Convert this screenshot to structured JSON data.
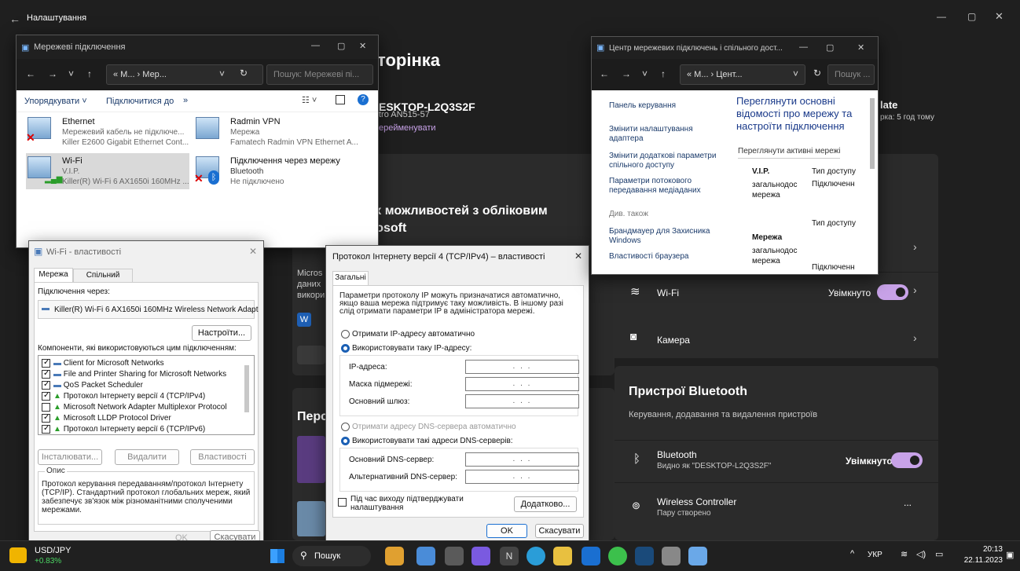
{
  "settings": {
    "title": "Налаштування",
    "heading_partial": "торінка",
    "device_name": "ESKTOP-L2Q3S2F",
    "device_model": "tro AN515-57",
    "rename": "ерейменувати",
    "update_partial": "late",
    "update_sub": "рка: 5 год тому",
    "ms_heading_1": "іх можливостей з обліковим",
    "ms_heading_2": "rosoft",
    "ms_text_1": "Micros",
    "ms_text_2": "даних",
    "ms_text_3": "викори",
    "personal_partial": "Перс",
    "wifi_label": "Wi-Fi",
    "wifi_state": "Увімкнуто",
    "camera_label": "Камера",
    "bt_section_title": "Пристрої Bluetooth",
    "bt_section_sub": "Керування, додавання та видалення пристроїв",
    "bt_label": "Bluetooth",
    "bt_sub": "Видно як \"DESKTOP-L2Q3S2F\"",
    "bt_state": "Увімкнуто",
    "ctrl_label": "Wireless Controller",
    "ctrl_sub": "Пару створено",
    "ctrl_more": "...",
    "accent": "#c8a2e8"
  },
  "netconn": {
    "title": "Мережеві підключення",
    "address": "« M... › Мер...",
    "search_placeholder": "Пошук: Мережеві пі...",
    "cmd_organize": "Упорядкувати ˅",
    "cmd_connect": "Підключитися до",
    "cmd_more": "»",
    "adapters": [
      {
        "name": "Ethernet",
        "status": "Мережевий кабель не підключе...",
        "device": "Killer E2600 Gigabit Ethernet Cont..."
      },
      {
        "name": "Radmin VPN",
        "status": "Мережа",
        "device": "Famatech Radmin VPN Ethernet A..."
      },
      {
        "name": "Wi-Fi",
        "status": "V.I.P.",
        "device": "Killer(R) Wi-Fi 6 AX1650i 160MHz ..."
      },
      {
        "name": "Підключення через мережу",
        "status": "Bluetooth",
        "device": "Не підключено"
      }
    ]
  },
  "wifiprops": {
    "title": "Wi-Fi - властивості",
    "tab_net": "Мережа",
    "tab_share": "Спільний доступ",
    "connect_via": "Підключення через:",
    "adapter": "Killer(R) Wi-Fi 6 AX1650i 160MHz Wireless Network Adapt",
    "configure": "Настроїти...",
    "components_label": "Компоненти, які використовуються цим підключенням:",
    "components": [
      {
        "label": "Client for Microsoft Networks",
        "checked": true
      },
      {
        "label": "File and Printer Sharing for Microsoft Networks",
        "checked": true
      },
      {
        "label": "QoS Packet Scheduler",
        "checked": true
      },
      {
        "label": "Протокол Інтернету версії 4 (TCP/IPv4)",
        "checked": true
      },
      {
        "label": "Microsoft Network Adapter Multiplexor Protocol",
        "checked": false
      },
      {
        "label": "Microsoft LLDP Protocol Driver",
        "checked": true
      },
      {
        "label": "Протокол Інтернету версії 6 (TCP/IPv6)",
        "checked": true
      }
    ],
    "install": "Інсталювати...",
    "remove": "Видалити",
    "properties": "Властивості",
    "desc_title": "Опис",
    "desc_text": "Протокол керування передаванням/протокол Інтернету (TCP/IP). Стандартний протокол глобальних мереж, який забезпечує зв'язок між різноманітними сполученими мережами.",
    "ok": "OK",
    "cancel": "Скасувати"
  },
  "ipv4": {
    "title": "Протокол Інтернету версії 4 (TCP/IPv4) – властивості",
    "tab": "Загальні",
    "intro": "Параметри протоколу IP можуть призначатися автоматично, якщо ваша мережа підтримує таку можливість. В іншому разі слід отримати параметри IP в адміністратора мережі.",
    "auto_ip": "Отримати IP-адресу автоматично",
    "manual_ip": "Використовувати таку IP-адресу:",
    "ip_label": "IP-адреса:",
    "mask_label": "Маска підмережі:",
    "gw_label": "Основний шлюз:",
    "auto_dns": "Отримати адресу DNS-сервера автоматично",
    "manual_dns": "Використовувати такі адреси DNS-серверів:",
    "dns1_label": "Основний DNS-сервер:",
    "dns2_label": "Альтернативний DNS-сервер:",
    "ip_placeholder": ". . .",
    "validate": "Під час виходу підтверджувати налаштування",
    "advanced": "Додатково...",
    "ok": "OK",
    "cancel": "Скасувати"
  },
  "netcenter": {
    "title": "Центр мережевих підключень і спільного дост...",
    "address": "« M... › Цент...",
    "search_placeholder": "Пошук ...",
    "side_home": "Панель керування",
    "side_adapter": "Змінити налаштування адаптера",
    "side_sharing": "Змінити додаткові параметри спільного доступу",
    "side_media": "Параметри потокового передавання медіаданих",
    "see_also": "Див. також",
    "firewall": "Брандмауер для Захисника Windows",
    "browser": "Властивості браузера",
    "main_heading": "Переглянути основні відомості про мережу та настроїти підключення",
    "active_nets": "Переглянути активні мережі",
    "net1_name": "V.I.P.",
    "net1_type": "загальнодос мережа",
    "access_type": "Тип доступу",
    "connections": "Підключенн",
    "net2_name": "Мережа",
    "net2_type": "загальнодос мережа",
    "access_type2": "Тип доступу",
    "connections2": "Підключенн"
  },
  "taskbar": {
    "ticker": "USD/JPY",
    "ticker_change": "+0.83%",
    "search": "Пошук",
    "lang": "УКР",
    "time": "20:13",
    "date": "22.11.2023"
  }
}
